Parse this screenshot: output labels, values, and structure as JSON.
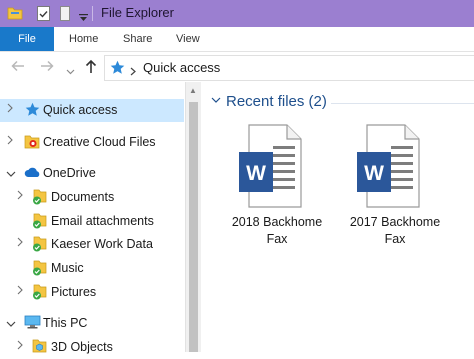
{
  "window": {
    "title": "File Explorer",
    "qat_icons": [
      "folder-icon",
      "properties-check-icon",
      "new-folder-icon",
      "customize-dropdown-icon"
    ]
  },
  "ribbon": {
    "tabs": [
      {
        "label": "File",
        "active": true
      },
      {
        "label": "Home"
      },
      {
        "label": "Share"
      },
      {
        "label": "View"
      }
    ]
  },
  "address_bar": {
    "back_icon": "arrow-left-icon",
    "forward_icon": "arrow-right-icon",
    "recent_icon": "chevron-down-icon",
    "up_icon": "arrow-up-icon",
    "location_icon": "star-icon",
    "separator_icon": "chevron-right-icon",
    "location": "Quick access"
  },
  "nav_pane": {
    "items": [
      {
        "label": "Quick access",
        "icon": "star-icon",
        "selected": true
      },
      {
        "label": "Creative Cloud Files",
        "icon": "creative-cloud-folder-icon"
      },
      {
        "label": "OneDrive",
        "icon": "cloud-icon",
        "expanded": true
      },
      {
        "label": "Documents",
        "icon": "synced-folder-icon"
      },
      {
        "label": "Email attachments",
        "icon": "synced-folder-icon"
      },
      {
        "label": "Kaeser Work Data",
        "icon": "synced-folder-icon"
      },
      {
        "label": "Music",
        "icon": "synced-folder-icon"
      },
      {
        "label": "Pictures",
        "icon": "synced-folder-icon"
      },
      {
        "label": "This PC",
        "icon": "computer-icon",
        "expanded": true
      },
      {
        "label": "3D Objects",
        "icon": "folder-icon"
      }
    ]
  },
  "content": {
    "group_title": "Recent files (2)",
    "files": [
      {
        "name": "2018 Backhome Fax",
        "icon": "word-document-icon"
      },
      {
        "name": "2017 Backhome Fax",
        "icon": "word-document-icon"
      }
    ]
  },
  "colors": {
    "title_bar": "#9b7fd0",
    "file_tab": "#1979ca",
    "selection": "#cce8ff",
    "group_header": "#1e4f8c",
    "word_blue": "#2b579a",
    "folder_yellow": "#f4c542",
    "sync_green": "#3aa745"
  }
}
